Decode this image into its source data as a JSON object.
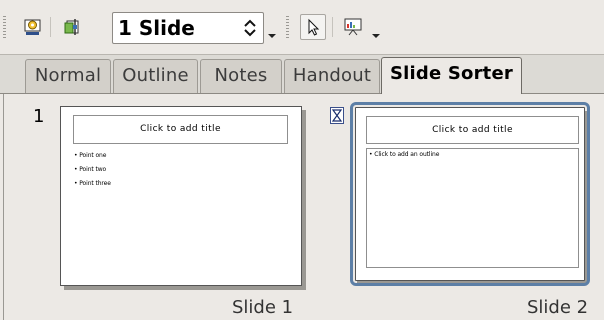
{
  "toolbar": {
    "slide_count_value": "1 Slide",
    "icons": [
      "slide-show-settings-icon",
      "slide-transition-icon",
      "spin-updown-icon",
      "select-pointer-icon",
      "presentation-icon"
    ]
  },
  "tabs": [
    {
      "label": "Normal",
      "active": false
    },
    {
      "label": "Outline",
      "active": false
    },
    {
      "label": "Notes",
      "active": false
    },
    {
      "label": "Handout",
      "active": false
    },
    {
      "label": "Slide Sorter",
      "active": true
    }
  ],
  "slides": [
    {
      "number": "1",
      "title_placeholder": "Click to add title",
      "bullets": [
        "Point one",
        "Point two",
        "Point three"
      ],
      "caption": "Slide 1",
      "selected": false
    },
    {
      "number": "",
      "title_placeholder": "Click to add title",
      "bullets": [
        "Click to add an outline"
      ],
      "caption": "Slide 2",
      "selected": true
    }
  ],
  "colors": {
    "selection": "#5d7fa6",
    "background": "#ece9e5"
  }
}
